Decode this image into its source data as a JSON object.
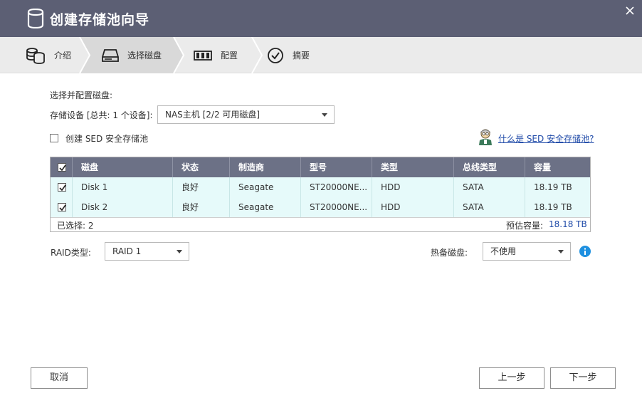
{
  "title": "创建存储池向导",
  "steps": [
    {
      "label": "介绍",
      "icon": "database-icon"
    },
    {
      "label": "选择磁盘",
      "icon": "hard-drive-icon"
    },
    {
      "label": "配置",
      "icon": "raid-config-icon"
    },
    {
      "label": "摘要",
      "icon": "check-circle-icon"
    }
  ],
  "active_step": 1,
  "section_label": "选择并配置磁盘:",
  "device_label": "存储设备 [总共: 1 个设备]:",
  "device_select": "NAS主机 [2/2 可用磁盘]",
  "sed_label": "创建 SED 安全存储池",
  "sed_link": "什么是 SED 安全存储池?",
  "table": {
    "headers": [
      "磁盘",
      "状态",
      "制造商",
      "型号",
      "类型",
      "总线类型",
      "容量"
    ],
    "rows": [
      [
        "Disk 1",
        "良好",
        "Seagate",
        "ST20000NE...",
        "HDD",
        "SATA",
        "18.19 TB"
      ],
      [
        "Disk 2",
        "良好",
        "Seagate",
        "ST20000NE...",
        "HDD",
        "SATA",
        "18.19 TB"
      ]
    ],
    "selected_text": "已选择: 2",
    "capacity_label": "预估容量:",
    "capacity_value": "18.18 TB"
  },
  "raid_label": "RAID类型:",
  "raid_select": "RAID 1",
  "spare_label": "热备磁盘:",
  "spare_select": "不使用",
  "buttons": {
    "cancel": "取消",
    "prev": "上一步",
    "next": "下一步"
  },
  "colors": {
    "titlebar": "#5c5f74",
    "table_header": "#6c7186",
    "row_bg": "#e6fafa",
    "link": "#1f4aa8",
    "info": "#1e90e0"
  }
}
